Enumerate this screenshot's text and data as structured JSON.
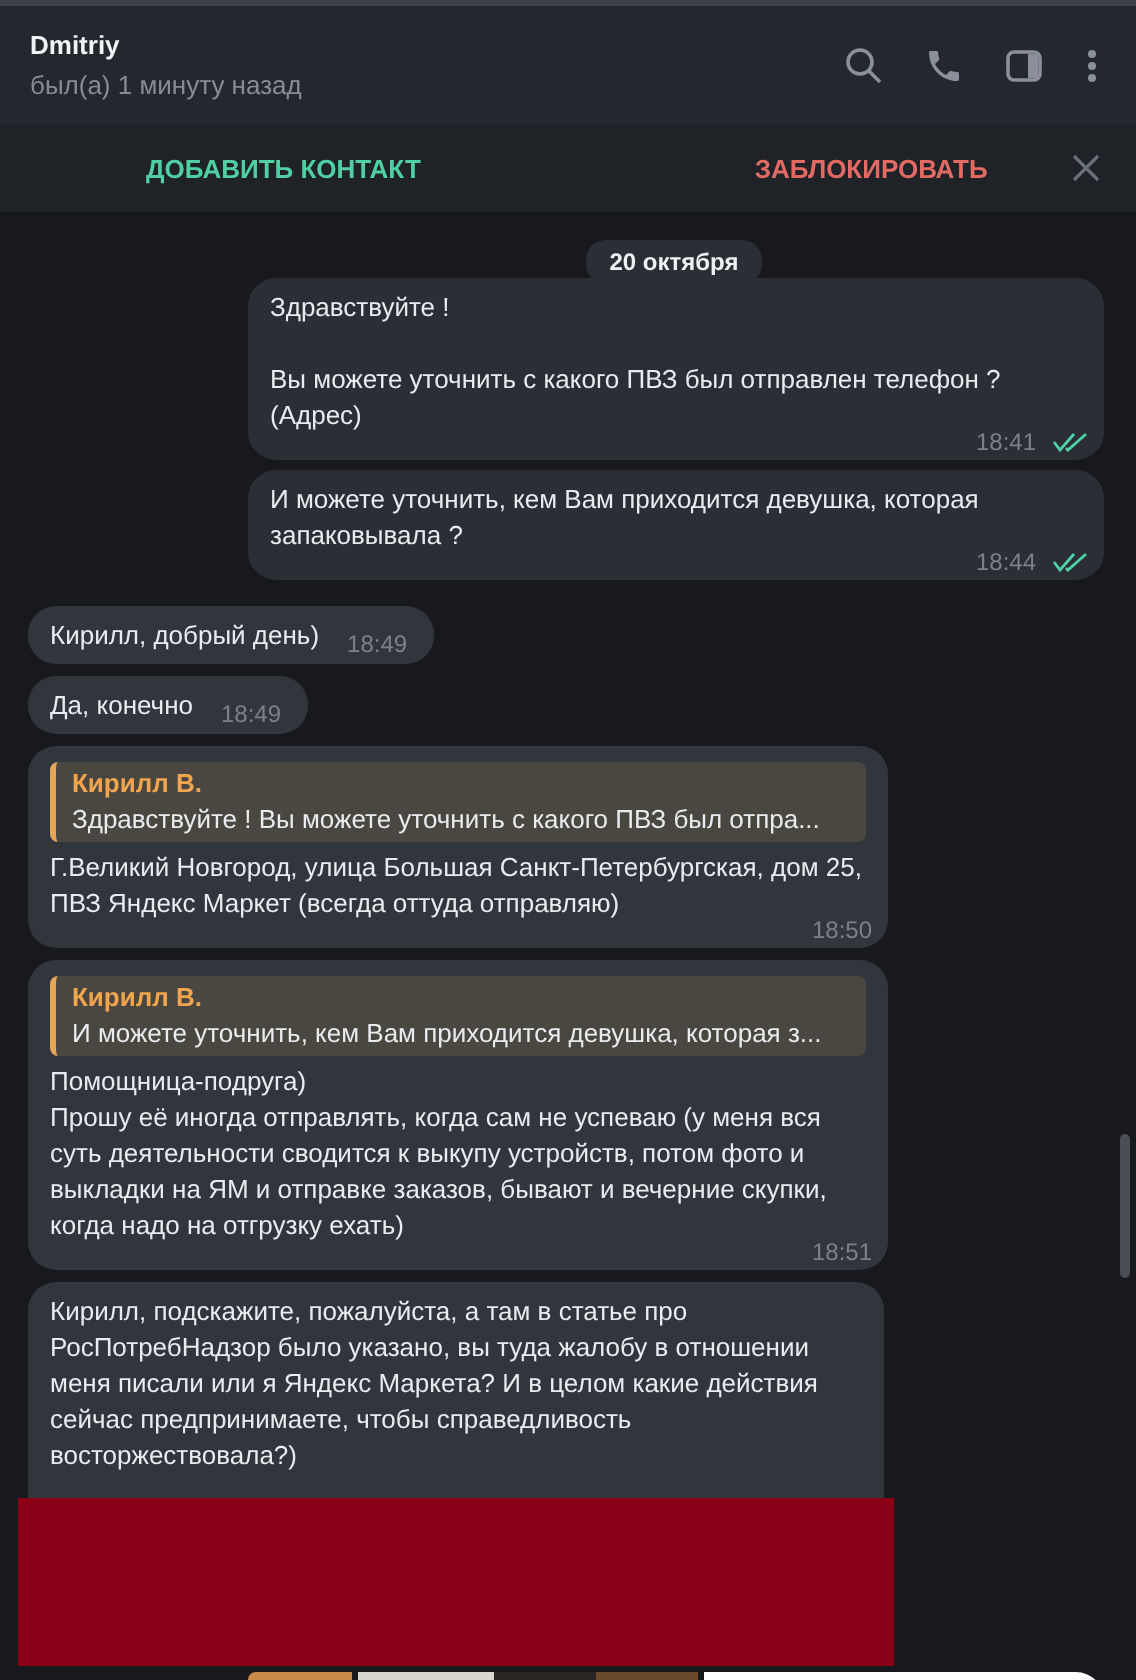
{
  "header": {
    "name": "Dmitriy",
    "status": "был(а) 1 минуту назад"
  },
  "action_bar": {
    "add_contact": "ДОБАВИТЬ КОНТАКТ",
    "block": "ЗАБЛОКИРОВАТЬ"
  },
  "date_badge": "20 октября",
  "messages": [
    {
      "outgoing": true,
      "text": "Здравствуйте !\n\nВы можете уточнить с какого ПВЗ был отправлен телефон ?\n(Адрес)",
      "time": "18:41",
      "read": true
    },
    {
      "outgoing": true,
      "text": "И можете уточнить, кем Вам приходится девушка, которая запаковывала ?",
      "time": "18:44",
      "read": true
    },
    {
      "outgoing": false,
      "text": "Кирилл, добрый день)",
      "time": "18:49"
    },
    {
      "outgoing": false,
      "text": "Да, конечно",
      "time": "18:49"
    },
    {
      "outgoing": false,
      "reply": {
        "author": "Кирилл В.",
        "text": "Здравствуйте !  Вы можете уточнить с какого ПВЗ был отпра..."
      },
      "text": "Г.Великий Новгород, улица Большая Санкт-Петербургская, дом 25, ПВЗ Яндекс Маркет (всегда оттуда отправляю)",
      "time": "18:50"
    },
    {
      "outgoing": false,
      "reply": {
        "author": "Кирилл В.",
        "text": "И можете уточнить, кем Вам приходится девушка, которая з..."
      },
      "text": "Помощница-подруга)\nПрошу её иногда отправлять, когда сам не успеваю (у меня вся суть деятельности сводится к выкупу устройств, потом фото и выкладки на ЯМ и отправке заказов, бывают и вечерние скупки, когда надо на отгрузку ехать)",
      "time": "18:51"
    },
    {
      "outgoing": false,
      "text": "Кирилл, подскажите, пожалуйста, а там в статье про РосПотребНадзор было указано, вы туда жалобу в отношении меня писали или я Яндекс Маркета? И в целом какие действия сейчас предпринимаете, чтобы справедливость восторжествовала?)",
      "redacted": true
    }
  ],
  "album": [
    {
      "kind": "picture"
    },
    {
      "kind": "picture"
    },
    {
      "kind": "blank"
    }
  ]
}
